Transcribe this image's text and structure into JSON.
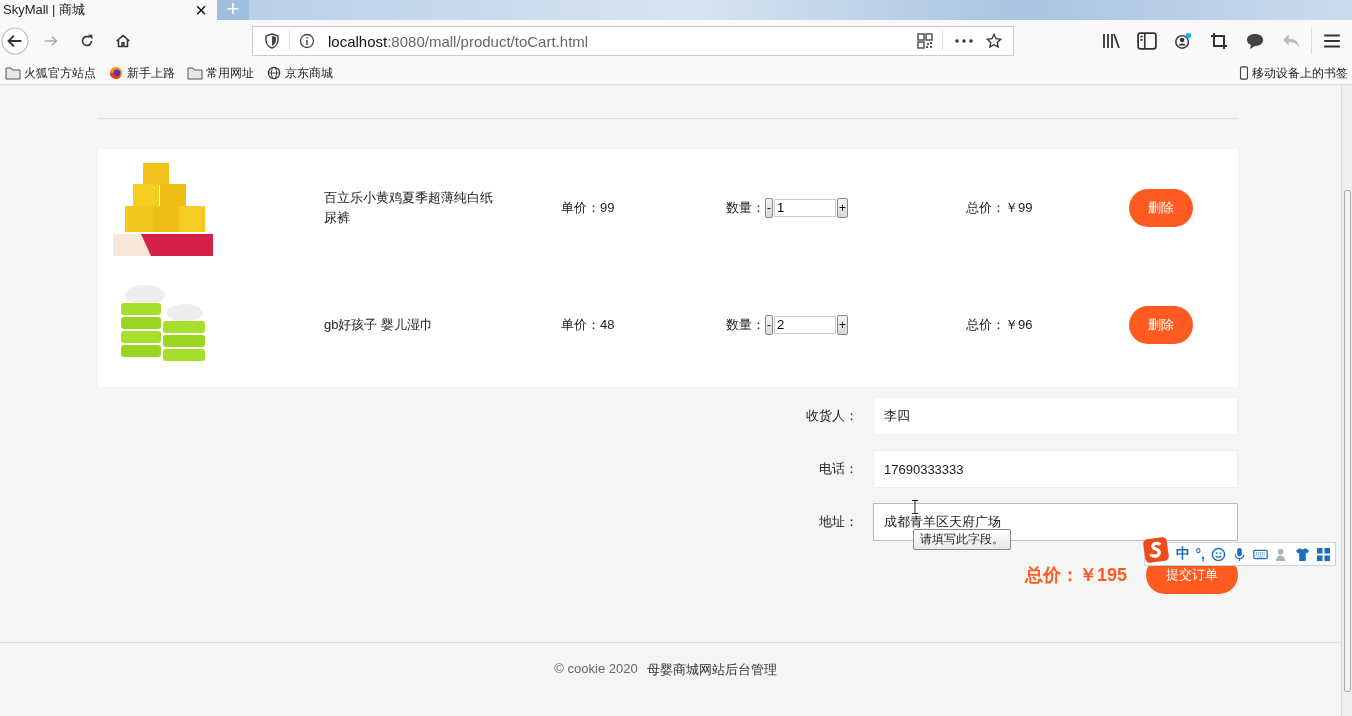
{
  "browser": {
    "tab_title": "SkyMall | 商城",
    "tab_close": "×",
    "new_tab": "+",
    "url_host": "localhost",
    "url_rest": ":8080/mall/product/toCart.html",
    "bookmarks": [
      {
        "label": "火狐官方站点",
        "kind": "folder"
      },
      {
        "label": "新手上路",
        "kind": "globe-color"
      },
      {
        "label": "常用网址",
        "kind": "folder"
      },
      {
        "label": "京东商城",
        "kind": "globe"
      }
    ],
    "mobile_bookmarks": "移动设备上的书签"
  },
  "cart": {
    "items": [
      {
        "name": "百立乐小黄鸡夏季超薄纯白纸尿裤",
        "price": "单价：99",
        "quantity_label": "数量：",
        "minus": "-",
        "quantity": "1",
        "plus": "+",
        "total": "总价：￥99",
        "delete": "删除",
        "kind": "yellow"
      },
      {
        "name": "gb好孩子 婴儿湿巾",
        "price": "单价：48",
        "quantity_label": "数量：",
        "minus": "-",
        "quantity": "2",
        "plus": "+",
        "total": "总价：￥96",
        "delete": "删除",
        "kind": "green"
      }
    ]
  },
  "form": {
    "fields": [
      {
        "label": "收货人：",
        "value": "李四"
      },
      {
        "label": "电话：",
        "value": "17690333333"
      },
      {
        "label": "地址：",
        "value": "成都青羊区天府广场"
      }
    ],
    "tooltip": "请填写此字段。",
    "order_total": "总价：￥195",
    "submit": "提交订单"
  },
  "ime_toolbar": {
    "mode": "中",
    "punctuation": "°,"
  },
  "footer": {
    "copyright": "© cookie 2020",
    "site": "母婴商城网站后台管理"
  }
}
